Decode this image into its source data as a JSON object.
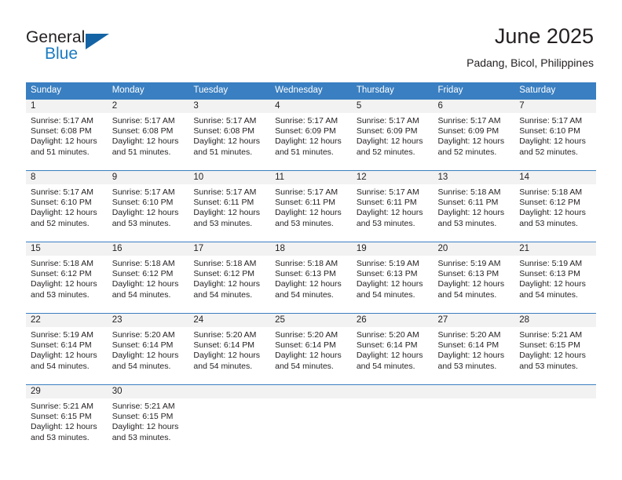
{
  "brand": {
    "name_part1": "General",
    "name_part2": "Blue",
    "flag_icon": "triangle-flag-icon"
  },
  "header": {
    "month_title": "June 2025",
    "location": "Padang, Bicol, Philippines"
  },
  "colors": {
    "header_blue": "#3a7fc1",
    "brand_blue": "#1a7bc1",
    "flag_blue": "#1464a5",
    "daynum_band": "#f2f2f2",
    "text": "#231f20"
  },
  "weekday_headers": [
    "Sunday",
    "Monday",
    "Tuesday",
    "Wednesday",
    "Thursday",
    "Friday",
    "Saturday"
  ],
  "weeks": [
    [
      {
        "day": "1",
        "sunrise": "Sunrise: 5:17 AM",
        "sunset": "Sunset: 6:08 PM",
        "daylight1": "Daylight: 12 hours",
        "daylight2": "and 51 minutes."
      },
      {
        "day": "2",
        "sunrise": "Sunrise: 5:17 AM",
        "sunset": "Sunset: 6:08 PM",
        "daylight1": "Daylight: 12 hours",
        "daylight2": "and 51 minutes."
      },
      {
        "day": "3",
        "sunrise": "Sunrise: 5:17 AM",
        "sunset": "Sunset: 6:08 PM",
        "daylight1": "Daylight: 12 hours",
        "daylight2": "and 51 minutes."
      },
      {
        "day": "4",
        "sunrise": "Sunrise: 5:17 AM",
        "sunset": "Sunset: 6:09 PM",
        "daylight1": "Daylight: 12 hours",
        "daylight2": "and 51 minutes."
      },
      {
        "day": "5",
        "sunrise": "Sunrise: 5:17 AM",
        "sunset": "Sunset: 6:09 PM",
        "daylight1": "Daylight: 12 hours",
        "daylight2": "and 52 minutes."
      },
      {
        "day": "6",
        "sunrise": "Sunrise: 5:17 AM",
        "sunset": "Sunset: 6:09 PM",
        "daylight1": "Daylight: 12 hours",
        "daylight2": "and 52 minutes."
      },
      {
        "day": "7",
        "sunrise": "Sunrise: 5:17 AM",
        "sunset": "Sunset: 6:10 PM",
        "daylight1": "Daylight: 12 hours",
        "daylight2": "and 52 minutes."
      }
    ],
    [
      {
        "day": "8",
        "sunrise": "Sunrise: 5:17 AM",
        "sunset": "Sunset: 6:10 PM",
        "daylight1": "Daylight: 12 hours",
        "daylight2": "and 52 minutes."
      },
      {
        "day": "9",
        "sunrise": "Sunrise: 5:17 AM",
        "sunset": "Sunset: 6:10 PM",
        "daylight1": "Daylight: 12 hours",
        "daylight2": "and 53 minutes."
      },
      {
        "day": "10",
        "sunrise": "Sunrise: 5:17 AM",
        "sunset": "Sunset: 6:11 PM",
        "daylight1": "Daylight: 12 hours",
        "daylight2": "and 53 minutes."
      },
      {
        "day": "11",
        "sunrise": "Sunrise: 5:17 AM",
        "sunset": "Sunset: 6:11 PM",
        "daylight1": "Daylight: 12 hours",
        "daylight2": "and 53 minutes."
      },
      {
        "day": "12",
        "sunrise": "Sunrise: 5:17 AM",
        "sunset": "Sunset: 6:11 PM",
        "daylight1": "Daylight: 12 hours",
        "daylight2": "and 53 minutes."
      },
      {
        "day": "13",
        "sunrise": "Sunrise: 5:18 AM",
        "sunset": "Sunset: 6:11 PM",
        "daylight1": "Daylight: 12 hours",
        "daylight2": "and 53 minutes."
      },
      {
        "day": "14",
        "sunrise": "Sunrise: 5:18 AM",
        "sunset": "Sunset: 6:12 PM",
        "daylight1": "Daylight: 12 hours",
        "daylight2": "and 53 minutes."
      }
    ],
    [
      {
        "day": "15",
        "sunrise": "Sunrise: 5:18 AM",
        "sunset": "Sunset: 6:12 PM",
        "daylight1": "Daylight: 12 hours",
        "daylight2": "and 53 minutes."
      },
      {
        "day": "16",
        "sunrise": "Sunrise: 5:18 AM",
        "sunset": "Sunset: 6:12 PM",
        "daylight1": "Daylight: 12 hours",
        "daylight2": "and 54 minutes."
      },
      {
        "day": "17",
        "sunrise": "Sunrise: 5:18 AM",
        "sunset": "Sunset: 6:12 PM",
        "daylight1": "Daylight: 12 hours",
        "daylight2": "and 54 minutes."
      },
      {
        "day": "18",
        "sunrise": "Sunrise: 5:18 AM",
        "sunset": "Sunset: 6:13 PM",
        "daylight1": "Daylight: 12 hours",
        "daylight2": "and 54 minutes."
      },
      {
        "day": "19",
        "sunrise": "Sunrise: 5:19 AM",
        "sunset": "Sunset: 6:13 PM",
        "daylight1": "Daylight: 12 hours",
        "daylight2": "and 54 minutes."
      },
      {
        "day": "20",
        "sunrise": "Sunrise: 5:19 AM",
        "sunset": "Sunset: 6:13 PM",
        "daylight1": "Daylight: 12 hours",
        "daylight2": "and 54 minutes."
      },
      {
        "day": "21",
        "sunrise": "Sunrise: 5:19 AM",
        "sunset": "Sunset: 6:13 PM",
        "daylight1": "Daylight: 12 hours",
        "daylight2": "and 54 minutes."
      }
    ],
    [
      {
        "day": "22",
        "sunrise": "Sunrise: 5:19 AM",
        "sunset": "Sunset: 6:14 PM",
        "daylight1": "Daylight: 12 hours",
        "daylight2": "and 54 minutes."
      },
      {
        "day": "23",
        "sunrise": "Sunrise: 5:20 AM",
        "sunset": "Sunset: 6:14 PM",
        "daylight1": "Daylight: 12 hours",
        "daylight2": "and 54 minutes."
      },
      {
        "day": "24",
        "sunrise": "Sunrise: 5:20 AM",
        "sunset": "Sunset: 6:14 PM",
        "daylight1": "Daylight: 12 hours",
        "daylight2": "and 54 minutes."
      },
      {
        "day": "25",
        "sunrise": "Sunrise: 5:20 AM",
        "sunset": "Sunset: 6:14 PM",
        "daylight1": "Daylight: 12 hours",
        "daylight2": "and 54 minutes."
      },
      {
        "day": "26",
        "sunrise": "Sunrise: 5:20 AM",
        "sunset": "Sunset: 6:14 PM",
        "daylight1": "Daylight: 12 hours",
        "daylight2": "and 54 minutes."
      },
      {
        "day": "27",
        "sunrise": "Sunrise: 5:20 AM",
        "sunset": "Sunset: 6:14 PM",
        "daylight1": "Daylight: 12 hours",
        "daylight2": "and 53 minutes."
      },
      {
        "day": "28",
        "sunrise": "Sunrise: 5:21 AM",
        "sunset": "Sunset: 6:15 PM",
        "daylight1": "Daylight: 12 hours",
        "daylight2": "and 53 minutes."
      }
    ],
    [
      {
        "day": "29",
        "sunrise": "Sunrise: 5:21 AM",
        "sunset": "Sunset: 6:15 PM",
        "daylight1": "Daylight: 12 hours",
        "daylight2": "and 53 minutes."
      },
      {
        "day": "30",
        "sunrise": "Sunrise: 5:21 AM",
        "sunset": "Sunset: 6:15 PM",
        "daylight1": "Daylight: 12 hours",
        "daylight2": "and 53 minutes."
      },
      {
        "day": "",
        "sunrise": "",
        "sunset": "",
        "daylight1": "",
        "daylight2": ""
      },
      {
        "day": "",
        "sunrise": "",
        "sunset": "",
        "daylight1": "",
        "daylight2": ""
      },
      {
        "day": "",
        "sunrise": "",
        "sunset": "",
        "daylight1": "",
        "daylight2": ""
      },
      {
        "day": "",
        "sunrise": "",
        "sunset": "",
        "daylight1": "",
        "daylight2": ""
      },
      {
        "day": "",
        "sunrise": "",
        "sunset": "",
        "daylight1": "",
        "daylight2": ""
      }
    ]
  ]
}
